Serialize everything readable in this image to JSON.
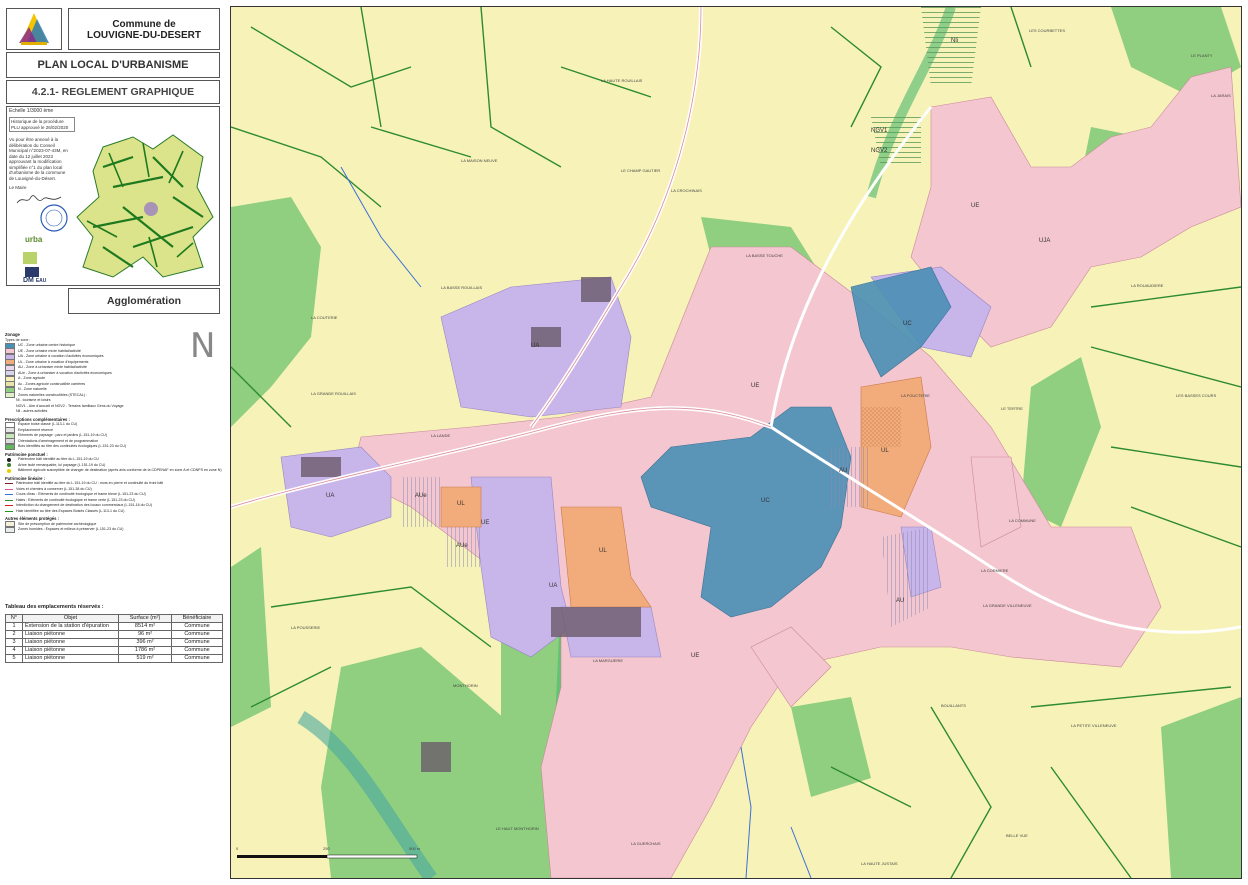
{
  "header": {
    "commune_line1": "Commune de",
    "commune_line2": "LOUVIGNE-DU-DESERT",
    "plu_title": "PLAN LOCAL D'URBANISME",
    "reglement_title": "4.2.1- REGLEMENT GRAPHIQUE",
    "scale": "Echelle 1/3000 ème",
    "history_line1": "Historique de la procédure",
    "history_line2": "PLU approuvé le 26/02/2020",
    "decision_text": "Vu pour être annexé à la délibération du Conseil Municipal n°2023-07-43M, en date du 12 juillet 2023 approuvant la modification simplifiée n°1 du plan local d'urbanisme de la commune de Louvigné-du-Désert.",
    "mayor_label": "Le Maire",
    "logo_urba": "urba",
    "logo_dm": "DM",
    "logo_dm_sub": "EAU",
    "sector_title": "Agglomération"
  },
  "legend": {
    "title": "Zonage",
    "zone_types_title": "Types de zone :",
    "zones": [
      {
        "label": "UC - Zone urbaine centre historique",
        "color": "#4a8fb5"
      },
      {
        "label": "UE - Zone urbaine mixte habitat/activité",
        "color": "#f4c6cf"
      },
      {
        "label": "UA - Zone urbaine à vocation d'activités économiques",
        "color": "#c8b5ea"
      },
      {
        "label": "UL - Zone urbaine à vocation d'équipements",
        "color": "#f2ab7a"
      },
      {
        "label": "AU - Zone à urbaniser mixte habitat/activité",
        "color": "#e9d7ee"
      },
      {
        "label": "AUe - Zone à urbaniser à vocation d'activités économiques",
        "color": "#d9d4ee"
      },
      {
        "label": "A - Zone agricole",
        "color": "#f7f3b8"
      },
      {
        "label": "Ac - Zones agricole constructible carrières",
        "color": "#e8e4a8"
      },
      {
        "label": "N - Zone naturelle",
        "color": "#8fcf7f"
      },
      {
        "label": "Zones naturelles constructibles (STECAL) :",
        "color": "#dff0c8"
      }
    ],
    "stecal_items": [
      "Nl - tourisme et loisirs",
      "NGV1 - Aire d'accueil et NGV2 - Terrains familiaux Gens du Voyage",
      "Nli - autres activités"
    ],
    "prescriptions_title": "Prescriptions complémentaires :",
    "prescriptions": [
      {
        "label": "Espace boisé classé (L.113-1 du CU)",
        "color": "#ffffff"
      },
      {
        "label": "Emplacement réservé",
        "color": "#e6e6e6"
      },
      {
        "label": "Eléments de paysage : parc et jardins (L.151-19 du CU)",
        "color": "#c9e6b8"
      },
      {
        "label": "Orientations d'aménagement et de programmation",
        "color": "#dddddd"
      },
      {
        "label": "Bois identifiés au titre des continuités écologiques (L.151-23 du CU)",
        "color": "#5fb85a"
      }
    ],
    "ponctuel_title": "Patrimoine ponctuel :",
    "ponctuel": [
      {
        "label": "Patrimoine bâti identifié au titre du L.151-19 du CU",
        "color": "#222222"
      },
      {
        "label": "Arbre isolé remarquable, lui paysage (L.151-19 du CU)",
        "color": "#3a7a2a"
      },
      {
        "label": "Bâtiment agricole susceptible de changer de destination (après avis conforme de la CDPENAF en zone A et CDNPS en zone N)",
        "color": "#e6d200"
      }
    ],
    "lineaire_title": "Patrimoine linéaire :",
    "lineaire": [
      {
        "label": "Patrimoine bâti identifié au titre du L.151-19 du CU : murs en pierre et continuité du front bâti",
        "color": "#7a1f1f"
      },
      {
        "label": "Voies et chemins à conserver (L.151-38 du CU)",
        "color": "#e05a9a"
      },
      {
        "label": "Cours d'eau : Eléments de continuité écologique et trame bleue (L.151-23 du CU)",
        "color": "#3a6fd8"
      },
      {
        "label": "Haies : Eléments de continuité écologique et trame verte (L.151-23 du CU)",
        "color": "#2e8b2e"
      },
      {
        "label": "Interdiction du changement de destination des locaux commerciaux (L.151-16 du CU)",
        "color": "#d62020"
      },
      {
        "label": "Haie identifiée au titre des Espaces Boisés Classés (L.113-1 du CU)",
        "color": "#1a9a1a"
      }
    ],
    "autres_title": "Autres éléments protégés :",
    "autres": [
      {
        "label": "Site de présomption de patrimoine archéologique",
        "color": "#f5f0d8"
      },
      {
        "label": "Zones humides : Espaces et milieux à préserver (L.151-23 du CU)",
        "color": "#e8ecec"
      }
    ]
  },
  "reserved_table": {
    "title": "Tableau des emplacements réservés :",
    "headers": [
      "N°",
      "Objet",
      "Surface (m²)",
      "Bénéficiaire"
    ],
    "rows": [
      [
        "1",
        "Extension de la station d'épuration",
        "8514 m²",
        "Commune"
      ],
      [
        "2",
        "Liaison piétonne",
        "96 m²",
        "Commune"
      ],
      [
        "3",
        "Liaison piétonne",
        "396 m²",
        "Commune"
      ],
      [
        "4",
        "Liaison piétonne",
        "1786 m²",
        "Commune"
      ],
      [
        "5",
        "Liaison piétonne",
        "519 m²",
        "Commune"
      ]
    ]
  },
  "map": {
    "north_symbol": "N",
    "scale_labels": [
      "0",
      "250",
      "500 m"
    ],
    "zone_labels": [
      "UA",
      "UA",
      "UA",
      "UC",
      "UC",
      "UL",
      "UL",
      "UL",
      "AU",
      "AU",
      "AUe",
      "AUe",
      "UE",
      "UE",
      "UE",
      "UE",
      "UJA",
      "NGV1",
      "NGV2",
      "Nli"
    ],
    "place_labels": [
      "LA HAUTE ROUILLAIS",
      "LA MAISON NEUVE",
      "LE CHAMP GAUTIER",
      "LA CROCHINAIS",
      "LA BASSE ROUILLAIS",
      "LA COUTERIE",
      "LA GRANDE ROUILLAIS",
      "LA LANDE",
      "LE HAUT MONTHORIN",
      "MONTHORIN",
      "LA GUERCHAIS",
      "LA GRANDE VILLENEUVE",
      "LA COMMUNE",
      "LA CORMIERE",
      "LE TERTRE",
      "LA FOUCTERIE",
      "LA HAUTE JUSTAIS",
      "BELLE VUE",
      "LA PETITE VILLENEUVE",
      "LE PLANTY",
      "LA JARAIS",
      "LES COURBETTES",
      "LA ROUAUDIERE",
      "LES BASSES COURS",
      "BOUILLANTS",
      "LA POUSSERIE",
      "LA MARGUERIE",
      "LA BASSE TOUCHE"
    ]
  }
}
